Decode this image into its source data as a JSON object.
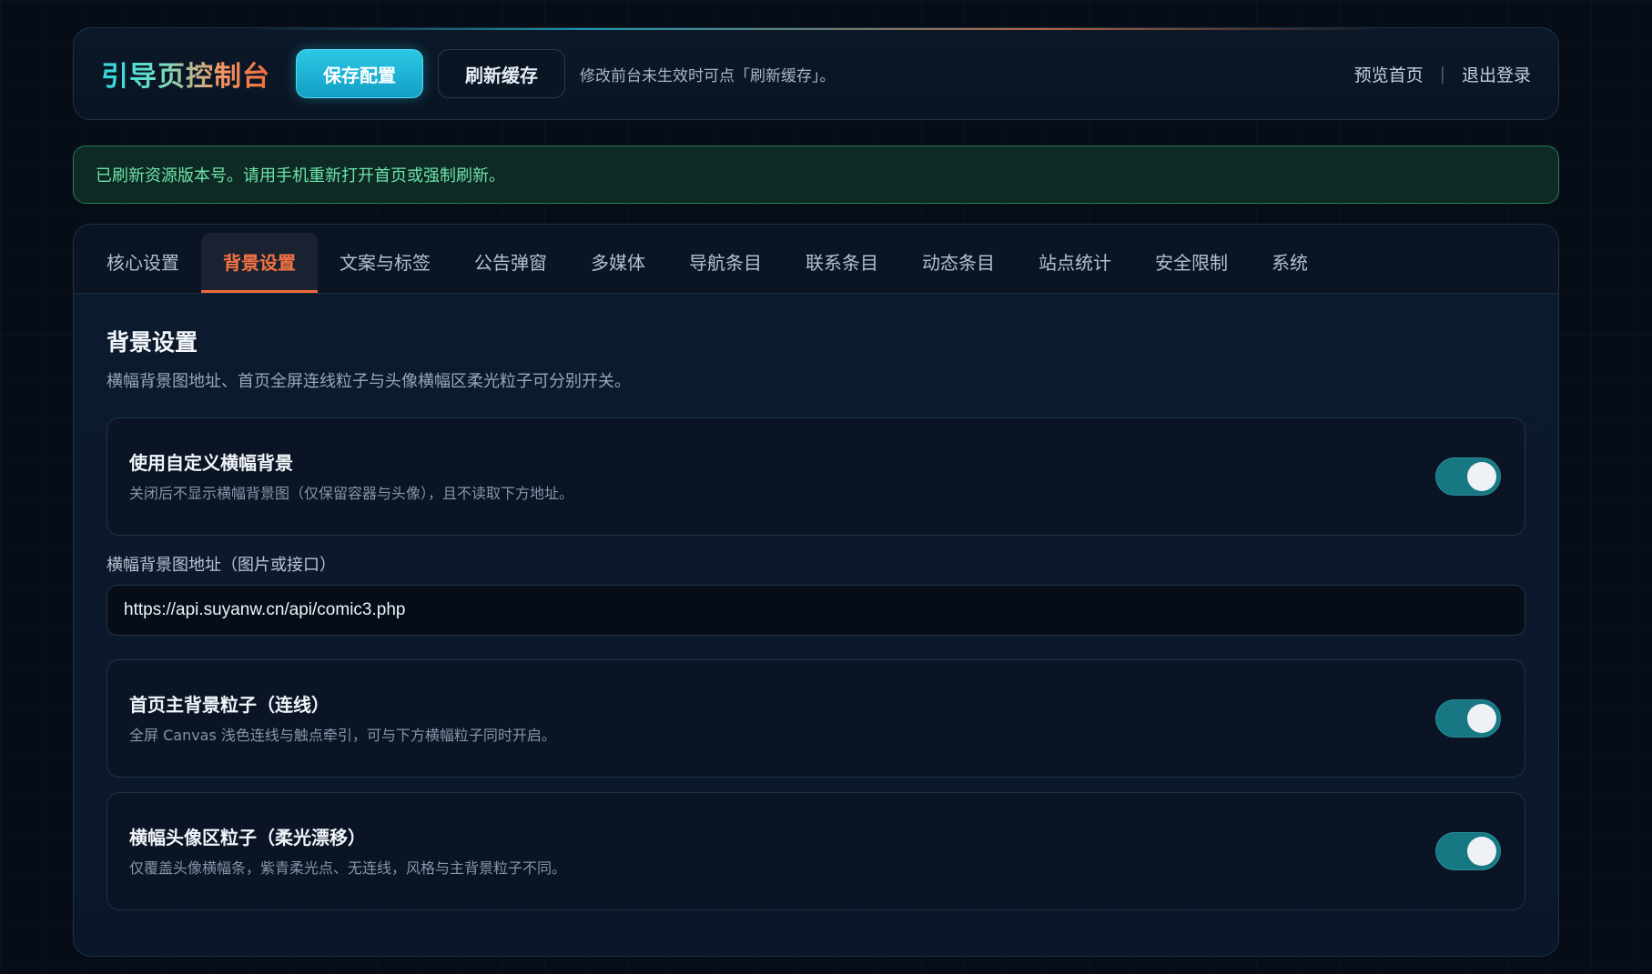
{
  "header": {
    "brand": "引导页控制台",
    "save_label": "保存配置",
    "refresh_label": "刷新缓存",
    "hint": "修改前台未生效时可点「刷新缓存」。",
    "preview_label": "预览首页",
    "separator": "|",
    "logout_label": "退出登录"
  },
  "notice": {
    "text": "已刷新资源版本号。请用手机重新打开首页或强制刷新。"
  },
  "tabs": [
    {
      "label": "核心设置",
      "active": false
    },
    {
      "label": "背景设置",
      "active": true
    },
    {
      "label": "文案与标签",
      "active": false
    },
    {
      "label": "公告弹窗",
      "active": false
    },
    {
      "label": "多媒体",
      "active": false
    },
    {
      "label": "导航条目",
      "active": false
    },
    {
      "label": "联系条目",
      "active": false
    },
    {
      "label": "动态条目",
      "active": false
    },
    {
      "label": "站点统计",
      "active": false
    },
    {
      "label": "安全限制",
      "active": false
    },
    {
      "label": "系统",
      "active": false
    }
  ],
  "section": {
    "title": "背景设置",
    "description": "横幅背景图地址、首页全屏连线粒子与头像横幅区柔光粒子可分别开关。",
    "custom_banner": {
      "title": "使用自定义横幅背景",
      "description": "关闭后不显示横幅背景图（仅保留容器与头像），且不读取下方地址。",
      "enabled": true
    },
    "banner_url": {
      "label": "横幅背景图地址（图片或接口）",
      "value": "https://api.suyanw.cn/api/comic3.php"
    },
    "main_particles": {
      "title": "首页主背景粒子（连线）",
      "description": "全屏 Canvas 浅色连线与触点牵引，可与下方横幅粒子同时开启。",
      "enabled": true
    },
    "banner_particles": {
      "title": "横幅头像区粒子（柔光漂移）",
      "description": "仅覆盖头像横幅条，紫青柔光点、无连线，风格与主背景粒子不同。",
      "enabled": true
    }
  },
  "colors": {
    "accent_cyan": "#22c3e0",
    "accent_orange": "#f06a3a",
    "success_green": "#6fe3a8",
    "toggle_on": "#177884"
  }
}
